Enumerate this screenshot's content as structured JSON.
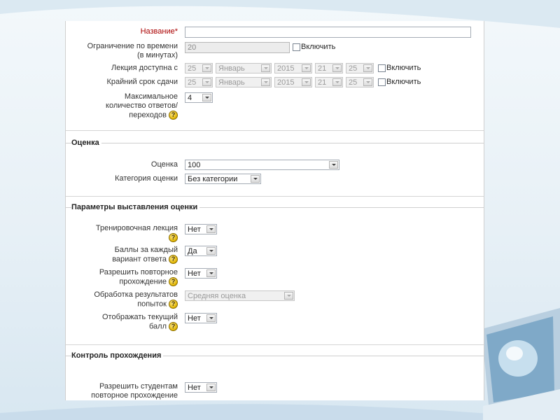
{
  "general": {
    "name_label": "Название",
    "name_required_mark": "*",
    "name_value": "",
    "time_limit_label_1": "Ограничение по времени",
    "time_limit_label_2": "(в минутах)",
    "time_limit_value": "20",
    "enable_label": "Включить",
    "available_from_label": "Лекция доступна с",
    "deadline_label": "Крайний срок сдачи",
    "date_day": "25",
    "date_month": "Январь",
    "date_year": "2015",
    "date_hour": "21",
    "date_minute": "25",
    "max_answers_label_1": "Максимальное",
    "max_answers_label_2": "количество ответов/",
    "max_answers_label_3": "переходов",
    "max_answers_value": "4"
  },
  "grade_section": {
    "legend": "Оценка",
    "grade_label": "Оценка",
    "grade_value": "100",
    "category_label": "Категория оценки",
    "category_value": "Без категории"
  },
  "grade_options": {
    "legend": "Параметры выставления оценки",
    "practice_label": "Тренировочная лекция",
    "practice_value": "Нет",
    "custom_scoring_label_1": "Баллы за каждый",
    "custom_scoring_label_2": "вариант ответа",
    "custom_scoring_value": "Да",
    "retake_label_1": "Разрешить повторное",
    "retake_label_2": "прохождение",
    "retake_value": "Нет",
    "handling_label_1": "Обработка результатов",
    "handling_label_2": "попыток",
    "handling_value": "Средняя оценка",
    "show_score_label_1": "Отображать текущий",
    "show_score_label_2": "балл",
    "show_score_value": "Нет"
  },
  "flow_control": {
    "legend": "Контроль прохождения",
    "student_review_label_1": "Разрешить студентам",
    "student_review_label_2": "повторное прохождение",
    "student_review_value": "Нет"
  },
  "icons": {
    "help": "?"
  },
  "colors": {
    "required": "#aa0000",
    "page_bg": "#ffffff"
  }
}
